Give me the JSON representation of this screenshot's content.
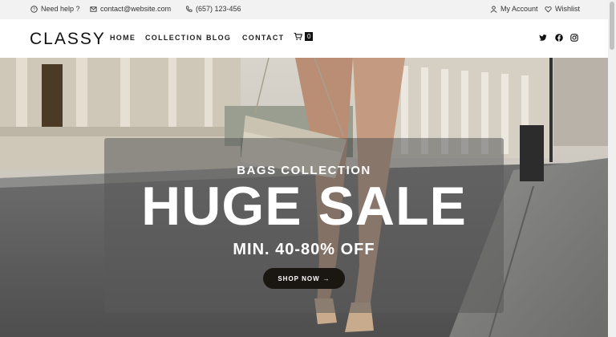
{
  "topbar": {
    "help": "Need help ?",
    "email": "contact@website.com",
    "phone": "(657) 123-456",
    "account": "My Account",
    "wishlist": "Wishlist"
  },
  "header": {
    "logo": "CLASSY",
    "nav": [
      "HOME",
      "COLLECTION",
      "BLOG",
      "CONTACT"
    ],
    "cart_count": "0",
    "social_icons": [
      "twitter-icon",
      "facebook-icon",
      "instagram-icon"
    ]
  },
  "hero": {
    "eyebrow": "BAGS COLLECTION",
    "headline": "HUGE SALE",
    "offer": "MIN. 40-80% OFF",
    "button_label": "SHOP NOW",
    "button_arrow": "→"
  }
}
